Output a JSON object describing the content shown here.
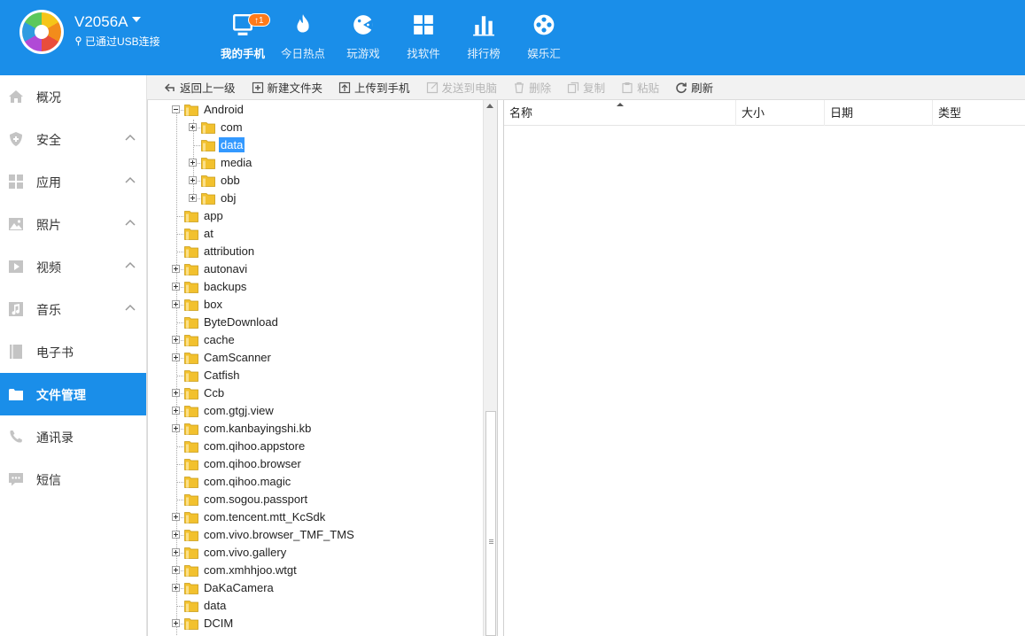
{
  "header": {
    "device_name": "V2056A",
    "connection_status": "已通过USB连接",
    "nav": [
      {
        "label": "我的手机",
        "icon": "phone-icon",
        "badge": "↑1",
        "active": true
      },
      {
        "label": "今日热点",
        "icon": "flame-icon"
      },
      {
        "label": "玩游戏",
        "icon": "game-icon"
      },
      {
        "label": "找软件",
        "icon": "apps-grid-icon"
      },
      {
        "label": "排行榜",
        "icon": "bar-chart-icon"
      },
      {
        "label": "娱乐汇",
        "icon": "film-reel-icon"
      }
    ]
  },
  "sidebar": {
    "items": [
      {
        "label": "概况",
        "icon": "home-icon"
      },
      {
        "label": "安全",
        "icon": "shield-icon",
        "chevron": true
      },
      {
        "label": "应用",
        "icon": "apps-icon",
        "chevron": true
      },
      {
        "label": "照片",
        "icon": "photo-icon",
        "chevron": true
      },
      {
        "label": "视频",
        "icon": "video-icon",
        "chevron": true
      },
      {
        "label": "音乐",
        "icon": "music-icon",
        "chevron": true
      },
      {
        "label": "电子书",
        "icon": "book-icon"
      },
      {
        "label": "文件管理",
        "icon": "folder-icon",
        "active": true
      },
      {
        "label": "通讯录",
        "icon": "phone-contact-icon"
      },
      {
        "label": "短信",
        "icon": "sms-icon"
      }
    ]
  },
  "toolbar": {
    "buttons": [
      {
        "label": "返回上一级",
        "icon": "back-arrow-icon",
        "enabled": true
      },
      {
        "label": "新建文件夹",
        "icon": "new-folder-icon",
        "enabled": true
      },
      {
        "label": "上传到手机",
        "icon": "upload-icon",
        "enabled": true
      },
      {
        "label": "发送到电脑",
        "icon": "send-icon",
        "enabled": false
      },
      {
        "label": "删除",
        "icon": "trash-icon",
        "enabled": false
      },
      {
        "label": "复制",
        "icon": "copy-icon",
        "enabled": false
      },
      {
        "label": "粘贴",
        "icon": "paste-icon",
        "enabled": false
      },
      {
        "label": "刷新",
        "icon": "refresh-icon",
        "enabled": true
      }
    ]
  },
  "tree": {
    "rows": [
      {
        "label": "Android",
        "level": 0,
        "expander": "minus"
      },
      {
        "label": "com",
        "level": 1,
        "expander": "plus"
      },
      {
        "label": "data",
        "level": 1,
        "expander": "none",
        "selected": true
      },
      {
        "label": "media",
        "level": 1,
        "expander": "plus"
      },
      {
        "label": "obb",
        "level": 1,
        "expander": "plus"
      },
      {
        "label": "obj",
        "level": 1,
        "expander": "plus"
      },
      {
        "label": "app",
        "level": 0,
        "expander": "none"
      },
      {
        "label": "at",
        "level": 0,
        "expander": "none"
      },
      {
        "label": "attribution",
        "level": 0,
        "expander": "none"
      },
      {
        "label": "autonavi",
        "level": 0,
        "expander": "plus"
      },
      {
        "label": "backups",
        "level": 0,
        "expander": "plus"
      },
      {
        "label": "box",
        "level": 0,
        "expander": "plus"
      },
      {
        "label": "ByteDownload",
        "level": 0,
        "expander": "none"
      },
      {
        "label": "cache",
        "level": 0,
        "expander": "plus"
      },
      {
        "label": "CamScanner",
        "level": 0,
        "expander": "plus"
      },
      {
        "label": "Catfish",
        "level": 0,
        "expander": "none"
      },
      {
        "label": "Ccb",
        "level": 0,
        "expander": "plus"
      },
      {
        "label": "com.gtgj.view",
        "level": 0,
        "expander": "plus"
      },
      {
        "label": "com.kanbayingshi.kb",
        "level": 0,
        "expander": "plus"
      },
      {
        "label": "com.qihoo.appstore",
        "level": 0,
        "expander": "none"
      },
      {
        "label": "com.qihoo.browser",
        "level": 0,
        "expander": "none"
      },
      {
        "label": "com.qihoo.magic",
        "level": 0,
        "expander": "none"
      },
      {
        "label": "com.sogou.passport",
        "level": 0,
        "expander": "none"
      },
      {
        "label": "com.tencent.mtt_KcSdk",
        "level": 0,
        "expander": "plus"
      },
      {
        "label": "com.vivo.browser_TMF_TMS",
        "level": 0,
        "expander": "plus"
      },
      {
        "label": "com.vivo.gallery",
        "level": 0,
        "expander": "plus"
      },
      {
        "label": "com.xmhhjoo.wtgt",
        "level": 0,
        "expander": "plus"
      },
      {
        "label": "DaKaCamera",
        "level": 0,
        "expander": "plus"
      },
      {
        "label": "data",
        "level": 0,
        "expander": "none"
      },
      {
        "label": "DCIM",
        "level": 0,
        "expander": "plus"
      }
    ]
  },
  "file_list": {
    "columns": [
      {
        "label": "名称",
        "name": "col-name"
      },
      {
        "label": "大小",
        "name": "col-size"
      },
      {
        "label": "日期",
        "name": "col-date"
      },
      {
        "label": "类型",
        "name": "col-type"
      }
    ]
  },
  "colors": {
    "brand_blue": "#1a8ee9",
    "selection_blue": "#3399ff",
    "badge_orange": "#ff7a1a",
    "folder_yellow": "#f2c12e"
  }
}
